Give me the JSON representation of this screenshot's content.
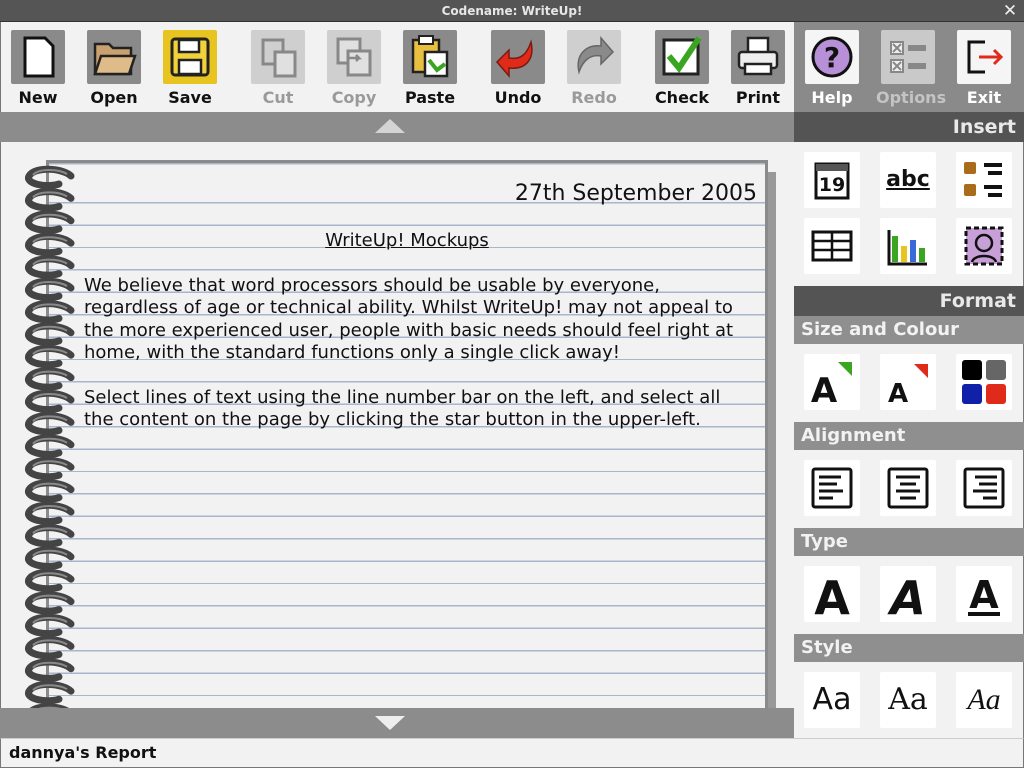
{
  "window": {
    "title": "Codename: WriteUp!",
    "close_symbol": "✕"
  },
  "toolbar": {
    "new": "New",
    "open": "Open",
    "save": "Save",
    "cut": "Cut",
    "copy": "Copy",
    "paste": "Paste",
    "undo": "Undo",
    "redo": "Redo",
    "check": "Check",
    "print": "Print",
    "help": "Help",
    "options": "Options",
    "exit": "Exit"
  },
  "document": {
    "date": "27th September 2005",
    "title": "WriteUp! Mockups",
    "paragraphs": [
      "We believe that word processors should be usable by everyone, regardless of age or technical ability. Whilst WriteUp! may not appeal to the more experienced user, people with basic needs should feel right at home, with the standard functions only a single click away!",
      "Select lines of text using the line number bar on the left, and select all the content on the page by clicking the star button in the upper-left."
    ]
  },
  "panel": {
    "insert_heading": "Insert",
    "format_heading": "Format",
    "size_colour": "Size and Colour",
    "alignment": "Alignment",
    "type": "Type",
    "style": "Style",
    "calendar_day": "19",
    "spellcheck_text": "abc",
    "style_sample": "Aa"
  },
  "colors": {
    "accent_check": "#3aa520",
    "undo_red": "#e02a1a",
    "help_purple": "#b890d8"
  },
  "statusbar": {
    "document_name": "dannya's Report"
  }
}
